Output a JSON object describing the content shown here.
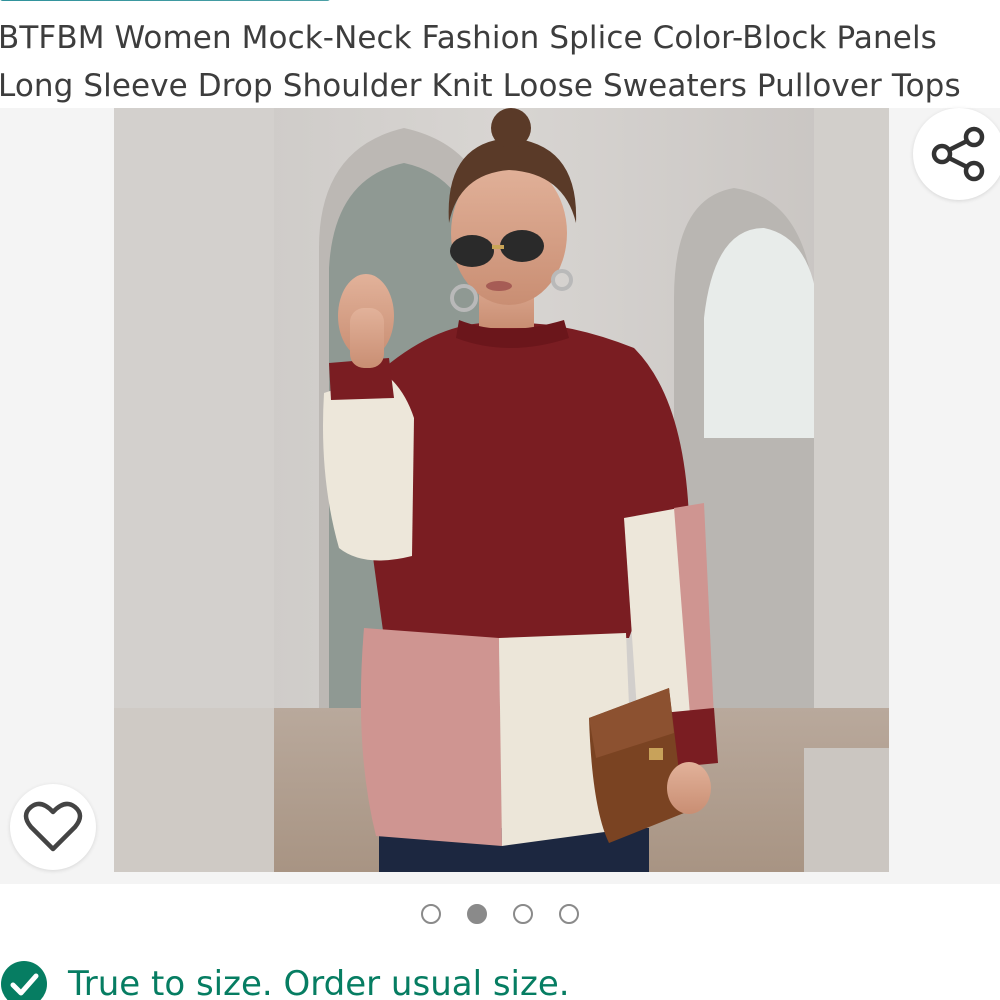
{
  "product": {
    "title": "BTFBM Women Mock-Neck Fashion Splice Color-Block Panels\nLong Sleeve Drop Shoulder Knit Loose Sweaters Pullover Tops"
  },
  "gallery": {
    "image_alt": "Woman in burgundy, pink and white color-block knit sweater holding a brown clutch",
    "dots": [
      {
        "active": false
      },
      {
        "active": true
      },
      {
        "active": false
      },
      {
        "active": false
      }
    ],
    "active_index": 1,
    "count": 4
  },
  "icons": {
    "share": "share-icon",
    "favorite": "heart-icon",
    "fit_check": "check-circle-icon"
  },
  "fit": {
    "message": "True to size. Order usual size."
  },
  "colors": {
    "title_text": "#3d3d3d",
    "fit_green": "#067d62",
    "check_green": "#067d62",
    "link_teal": "#007185"
  }
}
